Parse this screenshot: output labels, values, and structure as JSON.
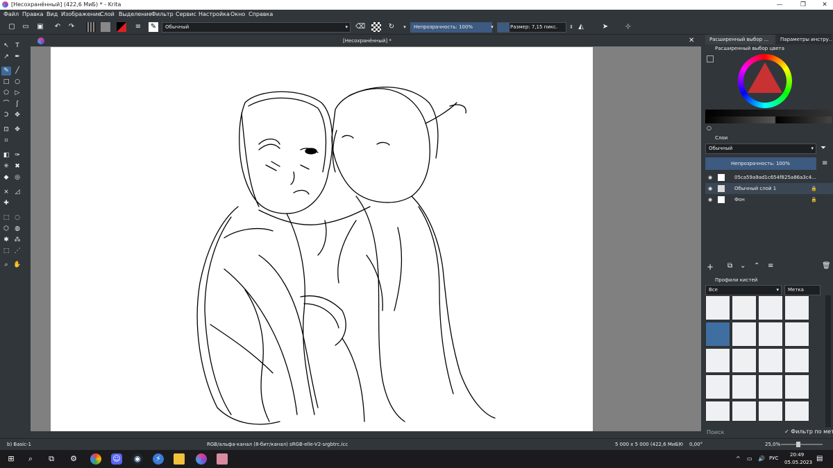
{
  "window": {
    "title": "[Несохранённый]  (422,6 МиБ)  * - Krita",
    "controls": [
      "—",
      "❐",
      "✕"
    ]
  },
  "menu": [
    "Файл",
    "Правка",
    "Вид",
    "Изображение",
    "Слой",
    "Выделение",
    "Фильтр",
    "Сервис",
    "Настройка",
    "Окно",
    "Справка"
  ],
  "toolbar": {
    "blend_mode": "Обычный",
    "opacity_label": "Непрозрачность: 100%",
    "size_label": "Размер: 7,15 пикс."
  },
  "document": {
    "tab_title": "[Несохранённый]  *",
    "close": "✕"
  },
  "right_panel": {
    "tab1": "Расширенный выбор ...",
    "tab2": "Параметры инстру...",
    "color_selector_title": "Расширенный выбор цвета",
    "layers_title": "Слои",
    "layers_blend": "Обычный",
    "layers_opacity": "Непрозрачность:  100%",
    "layers": [
      {
        "name": "05ca59a9ad1c654f825a86a3c4..."
      },
      {
        "name": "Обычный слой 1"
      },
      {
        "name": "Фон"
      }
    ],
    "brush_presets_title": "Профили кистей",
    "brush_filter": "Все",
    "brush_tag": "Метка",
    "search_placeholder": "Поиск",
    "filter_by_tag": "Фильтр по метке"
  },
  "status": {
    "brush": "b) Basic-1",
    "color_space": "RGB/альфа-канал (8-бит/канал)  sRGB-elle-V2-srgbtrc.icc",
    "image_size": "5 000 x 5 000 (422,6 МиБ)",
    "rotation": "0,00°",
    "zoom": "25,0%"
  },
  "taskbar": {
    "lang": "РУС",
    "time": "20:49",
    "date": "05.05.2023"
  }
}
